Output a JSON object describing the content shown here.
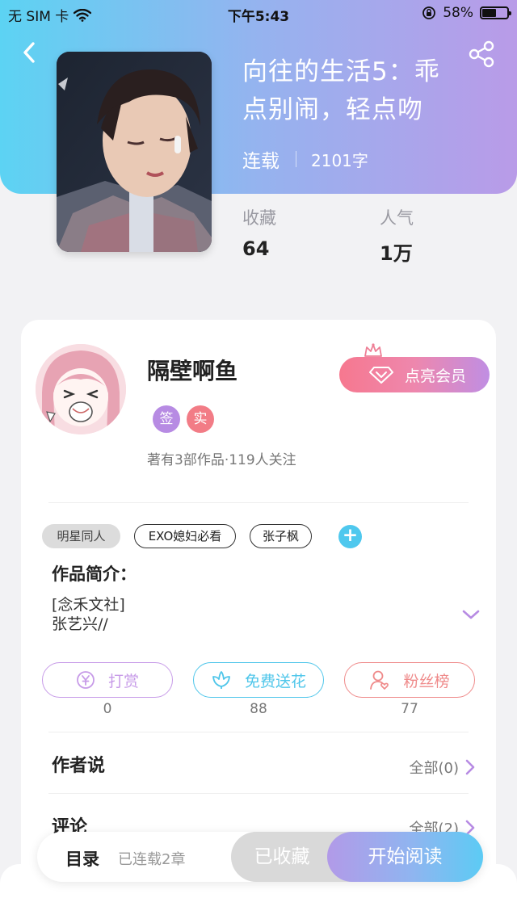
{
  "status_bar": {
    "carrier": "无 SIM 卡",
    "time": "下午5:43",
    "battery_percent": "58%",
    "battery_level": 0.58
  },
  "header": {
    "back_icon": "chevron-left-icon",
    "share_icon": "share-icon"
  },
  "book": {
    "title_line1": "向往的生活5：乖",
    "title_line2": "点别闹，轻点吻",
    "status": "连载",
    "word_count": "2101字",
    "stats": [
      {
        "label": "收藏",
        "value": "64"
      },
      {
        "label": "人气",
        "value": "1万"
      }
    ]
  },
  "author": {
    "name": "隔壁啊鱼",
    "badges": [
      {
        "text": "签",
        "color": "#b78be3"
      },
      {
        "text": "实",
        "color": "#f27c86"
      }
    ],
    "stats": "著有3部作品·119人关注",
    "vip_label": "点亮会员"
  },
  "tags": [
    "明星同人",
    "EXO媳妇必看",
    "张子枫"
  ],
  "intro": {
    "heading": "作品简介：",
    "lines": [
      "[念禾文社]",
      "张艺兴//"
    ]
  },
  "actions": [
    {
      "label": "打赏",
      "count": "0",
      "color": "#c79be8",
      "icon": "coin-icon"
    },
    {
      "label": "免费送花",
      "count": "88",
      "color": "#4fc6ea",
      "icon": "flower-icon"
    },
    {
      "label": "粉丝榜",
      "count": "77",
      "color": "#ef8a8a",
      "icon": "fan-user-icon"
    }
  ],
  "sections": [
    {
      "title": "作者说",
      "link": "全部(0)"
    },
    {
      "title": "评论",
      "link": "全部(2)"
    }
  ],
  "bottom_bar": {
    "toc_label": "目录",
    "chapter_count": "已连载2章",
    "collected_label": "已收藏",
    "read_label": "开始阅读"
  },
  "colors": {
    "header_gradient_start": "#5cd3f3",
    "header_gradient_end": "#b99be8",
    "accent_purple": "#b78be3",
    "accent_cyan": "#4fc8ee"
  }
}
